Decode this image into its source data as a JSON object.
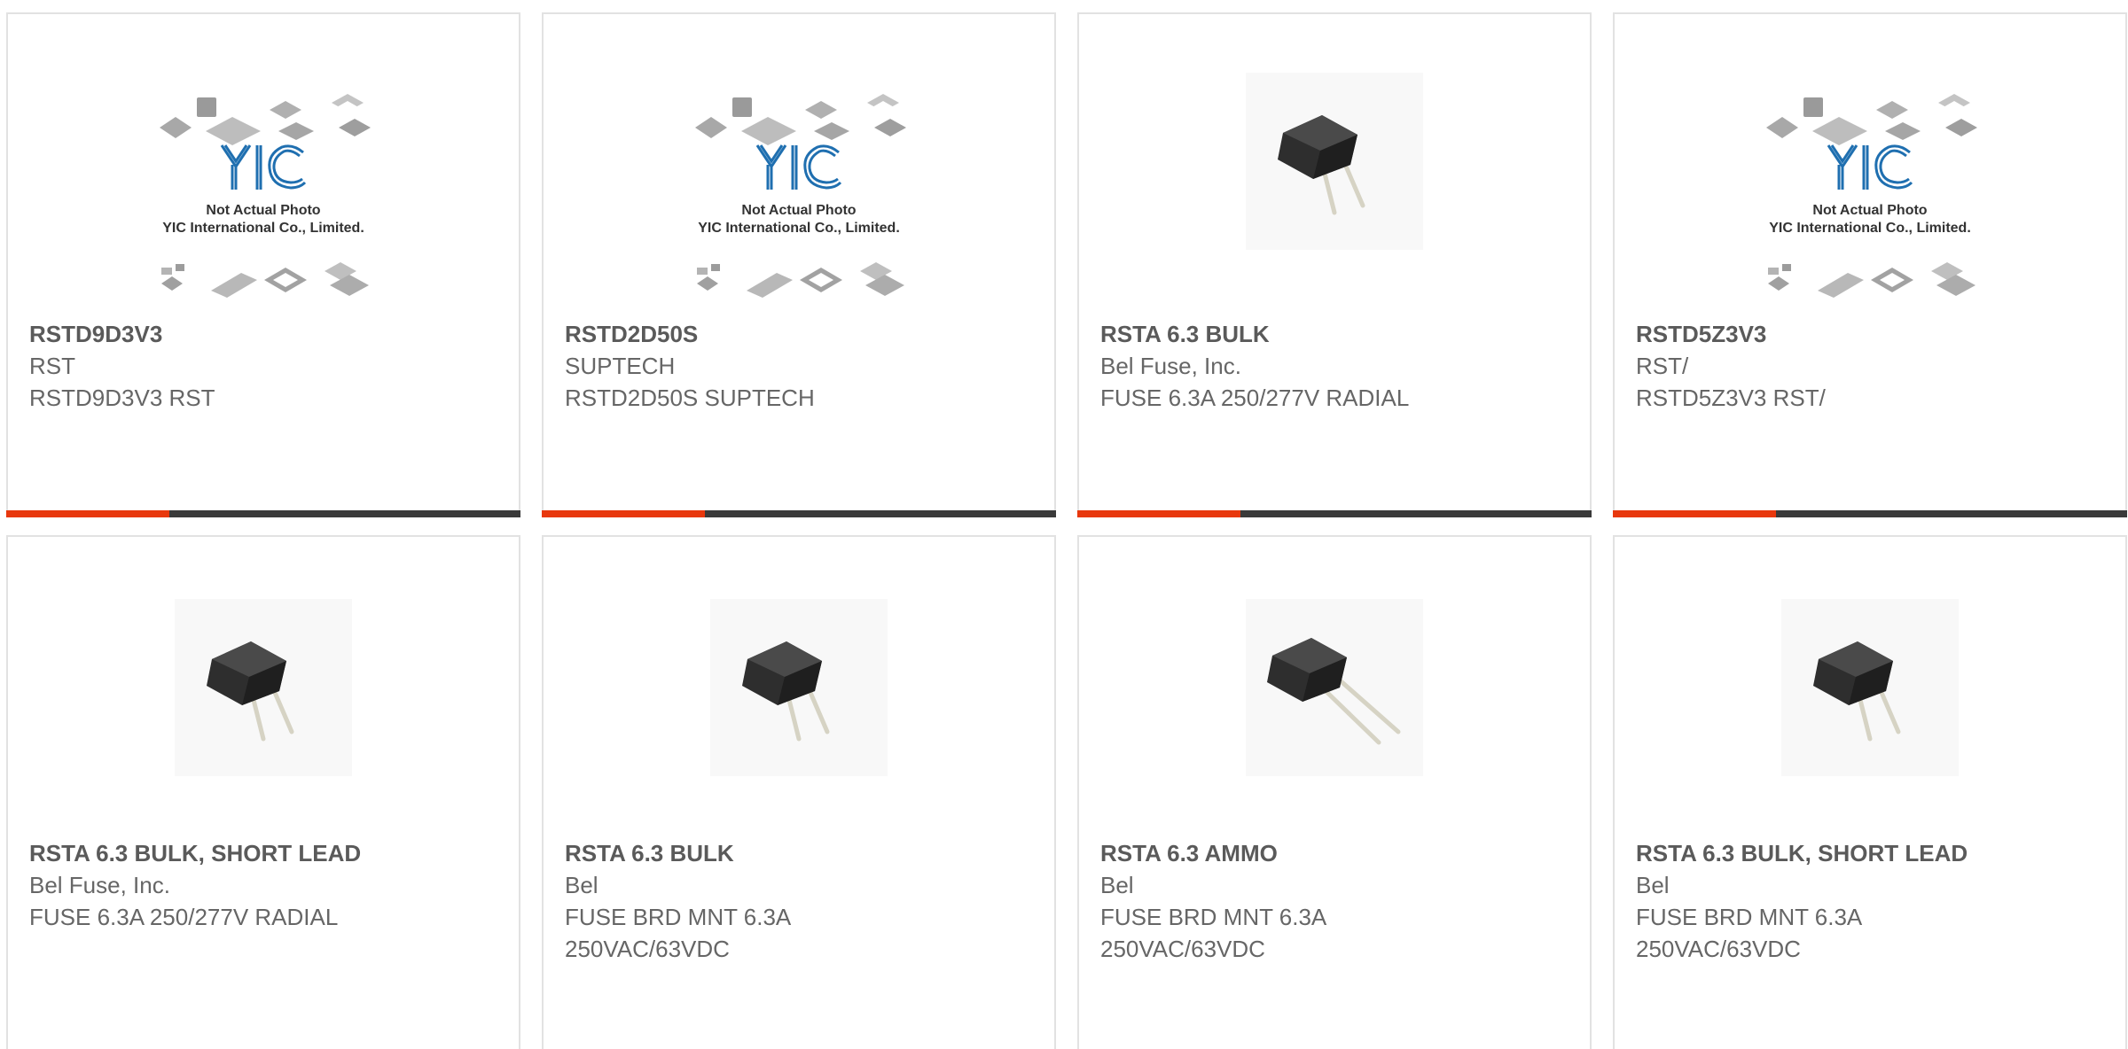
{
  "products": [
    {
      "part_number": "RSTD9D3V3",
      "manufacturer": "RST",
      "description": "RSTD9D3V3 RST",
      "image": "yic-placeholder",
      "placeholder_line1": "Not Actual Photo",
      "placeholder_line2": "YIC International Co., Limited.",
      "placeholder_logo": "YIC"
    },
    {
      "part_number": "RSTD2D50S",
      "manufacturer": "SUPTECH",
      "description": "RSTD2D50S SUPTECH",
      "image": "yic-placeholder",
      "placeholder_line1": "Not Actual Photo",
      "placeholder_line2": "YIC International Co., Limited.",
      "placeholder_logo": "YIC"
    },
    {
      "part_number": "RSTA 6.3 BULK",
      "manufacturer": "Bel Fuse, Inc.",
      "description": "FUSE 6.3A 250/277V RADIAL",
      "image": "radial-fuse"
    },
    {
      "part_number": "RSTD5Z3V3",
      "manufacturer": "RST/",
      "description": "RSTD5Z3V3 RST/",
      "image": "yic-placeholder",
      "placeholder_line1": "Not Actual Photo",
      "placeholder_line2": "YIC International Co., Limited.",
      "placeholder_logo": "YIC"
    },
    {
      "part_number": "RSTA 6.3 BULK, SHORT LEAD",
      "manufacturer": "Bel Fuse, Inc.",
      "description": "FUSE 6.3A 250/277V RADIAL",
      "image": "radial-fuse"
    },
    {
      "part_number": "RSTA 6.3 BULK",
      "manufacturer": "Bel",
      "description": "FUSE BRD MNT 6.3A 250VAC/63VDC",
      "image": "radial-fuse"
    },
    {
      "part_number": "RSTA 6.3 AMMO",
      "manufacturer": "Bel",
      "description": "FUSE BRD MNT 6.3A 250VAC/63VDC",
      "image": "radial-fuse-long-lead"
    },
    {
      "part_number": "RSTA 6.3 BULK, SHORT LEAD",
      "manufacturer": "Bel",
      "description": "FUSE BRD MNT 6.3A 250VAC/63VDC",
      "image": "radial-fuse"
    }
  ],
  "colors": {
    "accent": "#e8380d",
    "bar": "#3a3a3a",
    "border": "#e2e2e2",
    "text": "#666666",
    "placeholder_logo": "#1f6fb0"
  }
}
